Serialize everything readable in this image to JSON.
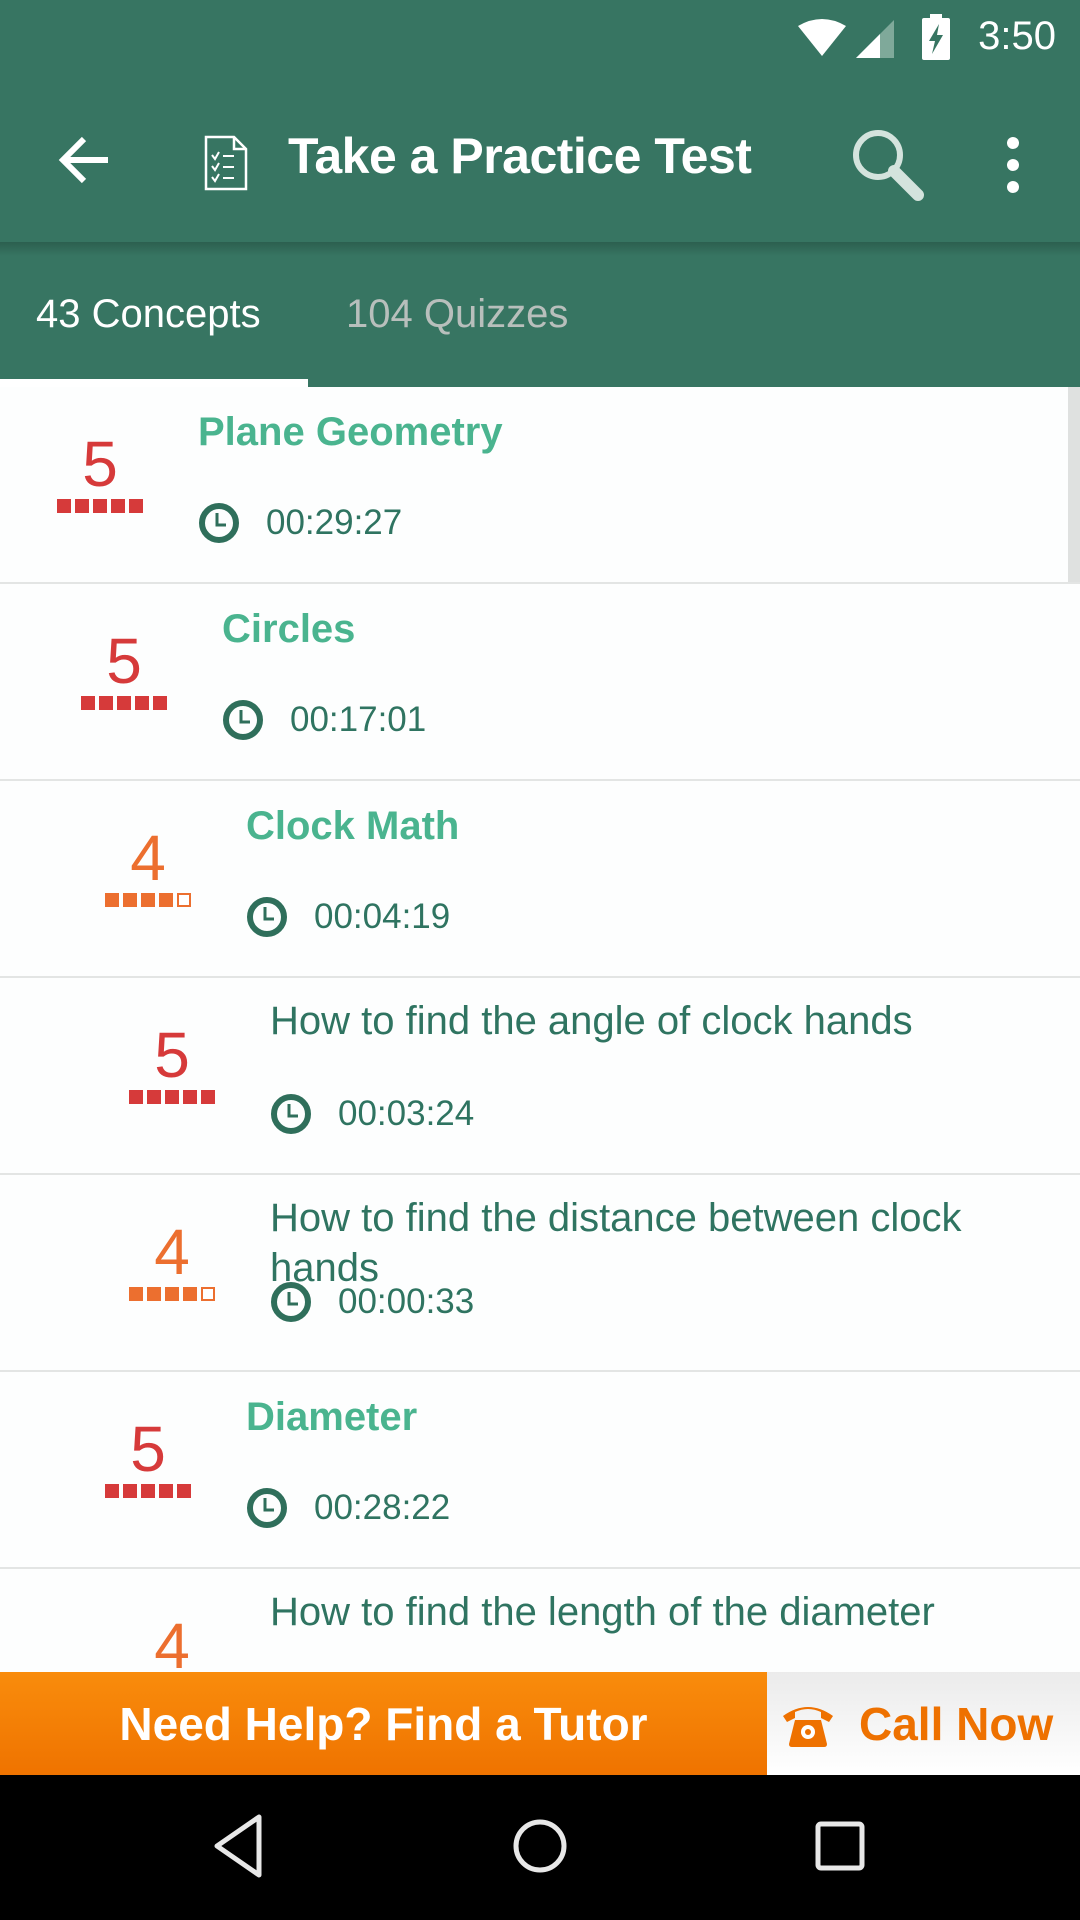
{
  "status_bar": {
    "time": "3:50",
    "icons": [
      "wifi-icon",
      "signal-icon",
      "battery-charging-icon"
    ]
  },
  "app_bar": {
    "title": "Take a Practice Test",
    "icons": [
      "back-arrow-icon",
      "checklist-document-icon",
      "search-icon",
      "more-vert-icon"
    ]
  },
  "tabs": [
    {
      "label": "43 Concepts",
      "selected": true
    },
    {
      "label": "104 Quizzes",
      "selected": false
    }
  ],
  "list": {
    "scroll_position": 0,
    "items": [
      {
        "title": "Plane Geometry",
        "time": "00:29:27",
        "score": "5",
        "score_value": 5,
        "score_max": 5,
        "level": 0,
        "style": "concept"
      },
      {
        "title": "Circles",
        "time": "00:17:01",
        "score": "5",
        "score_value": 5,
        "score_max": 5,
        "level": 1,
        "style": "concept"
      },
      {
        "title": "Clock Math",
        "time": "00:04:19",
        "score": "4",
        "score_value": 4,
        "score_max": 5,
        "level": 2,
        "style": "concept"
      },
      {
        "title": "How to find the angle of clock hands",
        "time": "00:03:24",
        "score": "5",
        "score_value": 5,
        "score_max": 5,
        "level": 3,
        "style": "lesson"
      },
      {
        "title": "How to find the distance between clock hands",
        "time": "00:00:33",
        "score": "4",
        "score_value": 4,
        "score_max": 5,
        "level": 3,
        "style": "lesson"
      },
      {
        "title": "Diameter",
        "time": "00:28:22",
        "score": "5",
        "score_value": 5,
        "score_max": 5,
        "level": 2,
        "style": "concept"
      },
      {
        "title": "How to find the length of the diameter",
        "time": "",
        "score": "4",
        "score_value": 4,
        "score_max": 5,
        "level": 3,
        "style": "lesson"
      }
    ]
  },
  "colors": {
    "primary": "#377562",
    "concept_title": "#4ab48f",
    "lesson_title": "#2f7461",
    "score_5": "#d63a3a",
    "score_4": "#ec6f2f",
    "banner_orange": "#f28000"
  },
  "banner": {
    "tutor_label": "Need Help? Find a Tutor",
    "call_label": "Call Now",
    "call_icon": "phone-icon"
  },
  "nav_bar": {
    "buttons": [
      "back-triangle-icon",
      "home-circle-icon",
      "recents-square-icon"
    ]
  }
}
